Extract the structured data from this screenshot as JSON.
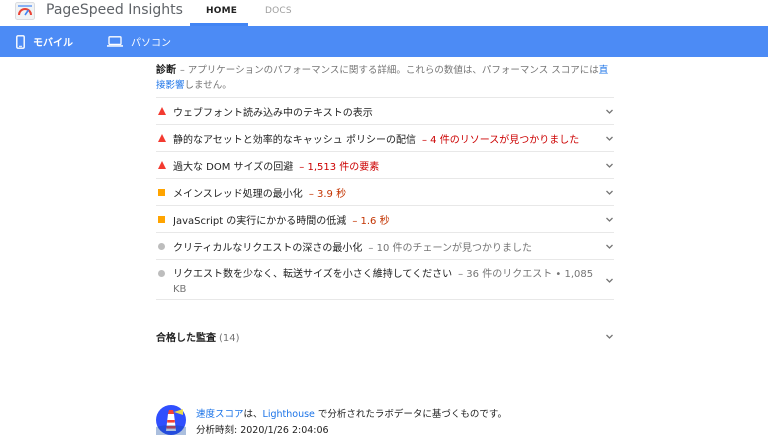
{
  "header": {
    "brand": "PageSpeed Insights",
    "tabs": [
      {
        "label": "HOME",
        "active": true
      },
      {
        "label": "DOCS",
        "active": false
      }
    ]
  },
  "device_tabs": [
    {
      "label": "モバイル",
      "icon": "phone-icon",
      "active": true
    },
    {
      "label": "パソコン",
      "icon": "laptop-icon",
      "active": false
    }
  ],
  "diagnostics": {
    "title": "診断",
    "description_prefix": "– アプリケーションのパフォーマンスに関する詳細。これらの数値は、パフォーマンス スコアには",
    "link": "直接影響",
    "description_suffix": "しません。"
  },
  "audits": [
    {
      "severity": "fail",
      "label": "ウェブフォント読み込み中のテキストの表示",
      "detail": ""
    },
    {
      "severity": "fail",
      "label": "静的なアセットと効率的なキャッシュ ポリシーの配信",
      "detail": "4 件のリソースが見つかりました"
    },
    {
      "severity": "fail",
      "label": "過大な DOM サイズの回避",
      "detail": "1,513 件の要素"
    },
    {
      "severity": "average",
      "label": "メインスレッド処理の最小化",
      "detail": "3.9 秒"
    },
    {
      "severity": "average",
      "label": "JavaScript の実行にかかる時間の低減",
      "detail": "1.6 秒"
    },
    {
      "severity": "info",
      "label": "クリティカルなリクエストの深さの最小化",
      "detail": "10 件のチェーンが見つかりました"
    },
    {
      "severity": "info",
      "label": "リクエスト数を少なく、転送サイズを小さく維持してください",
      "detail": "36 件のリクエスト • 1,085 KB"
    }
  ],
  "passed": {
    "label": "合格した監査",
    "count": "(14)"
  },
  "footer": {
    "speed_score": "速度スコア",
    "text1": "は、",
    "lighthouse": "Lighthouse",
    "text2": " で分析されたラボデータに基づくものです。",
    "analysis_time": "分析時刻: 2020/1/26 2:04:06"
  },
  "colors": {
    "accent": "#4c8bf5",
    "fail": "#f33a30",
    "average": "#ffa400",
    "info": "#bdbdbd",
    "link": "#1a73e8"
  }
}
